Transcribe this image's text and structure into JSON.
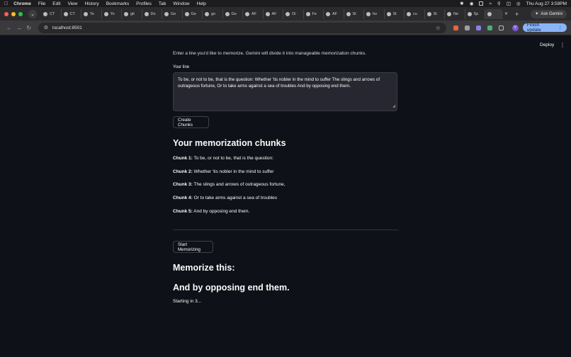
{
  "menubar": {
    "app": "Chrome",
    "items": [
      "File",
      "Edit",
      "View",
      "History",
      "Bookmarks",
      "Profiles",
      "Tab",
      "Window",
      "Help"
    ],
    "clock": "Thu Aug 27  3:59PM"
  },
  "tabs": [
    "CT",
    "CT",
    "Te",
    "Yo",
    "git",
    "Do",
    "Ge",
    "Ge",
    "go",
    "Ge",
    "AF",
    "AF",
    "Oi",
    "Fe",
    "AF",
    "St",
    "ho",
    "St",
    "cu",
    "St",
    "Ne",
    "Sp",
    ""
  ],
  "tabstrip": {
    "ask_gemini": "Ask Gemini"
  },
  "toolbar": {
    "url": "localhost:8501",
    "avatar_letter": "V",
    "finish_update": "Finish update"
  },
  "app_header": {
    "deploy": "Deploy"
  },
  "form": {
    "intro": "Enter a line you'd like to memorize. Gemini will divide it into manageable memorization chunks.",
    "label": "Your line",
    "value": "To be, or not to be, that is the question: Whether 'tis nobler in the mind to suffer The slings and arrows of outrageous fortune, Or to take arms against a sea of troubles And by opposing end them.",
    "create_button": "Create Chunks"
  },
  "chunks": {
    "title": "Your memorization chunks",
    "items": [
      {
        "label": "Chunk 1:",
        "text": " To be, or not to be, that is the question:"
      },
      {
        "label": "Chunk 2:",
        "text": " Whether 'tis nobler in the mind to suffer"
      },
      {
        "label": "Chunk 3:",
        "text": " The slings and arrows of outrageous fortune,"
      },
      {
        "label": "Chunk 4:",
        "text": " Or to take arms against a sea of troubles"
      },
      {
        "label": "Chunk 5:",
        "text": " And by opposing end them."
      }
    ]
  },
  "memorize": {
    "start_button": "Start Memorizing",
    "title": "Memorize this:",
    "line": "And by opposing end them.",
    "countdown": "Starting in 3..."
  }
}
